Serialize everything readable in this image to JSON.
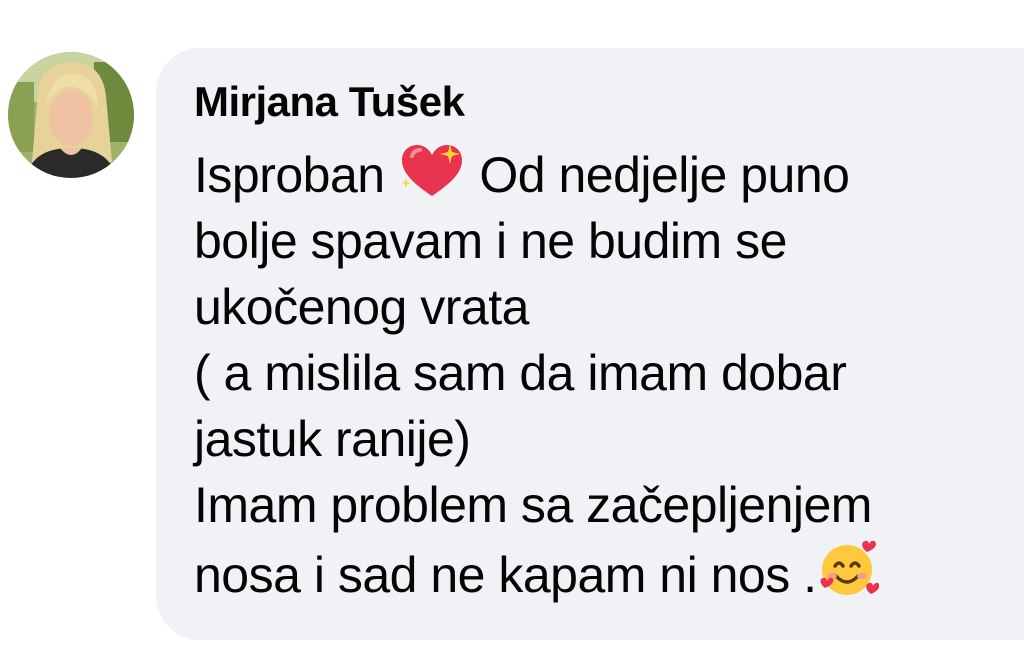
{
  "comment": {
    "author": "Mirjana Tušek",
    "lines": [
      {
        "before": "Isproban ",
        "emoji": "sparkling-heart-icon",
        "after": " Od nedjelje puno"
      },
      {
        "text": "bolje spavam i ne budim se"
      },
      {
        "text": "ukočenog vrata"
      },
      {
        "text": "( a mislila sam da imam dobar"
      },
      {
        "text": "jastuk ranije)"
      },
      {
        "text": "Imam problem sa začepljenjem"
      },
      {
        "before": "nosa i sad ne kapam ni nos .",
        "emoji": "smiling-face-with-hearts-icon"
      }
    ]
  },
  "colors": {
    "bubble": "#f0f2f5",
    "text": "#050505"
  }
}
